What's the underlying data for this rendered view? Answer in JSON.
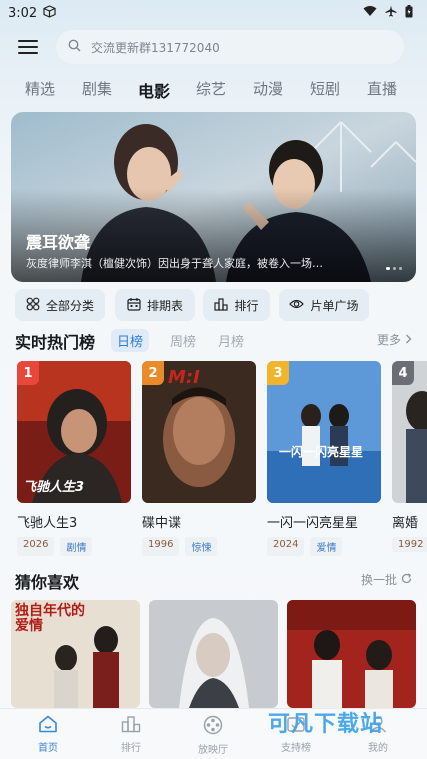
{
  "status_bar": {
    "time": "3:02"
  },
  "search": {
    "placeholder": "交流更新群131772040"
  },
  "tabs": [
    {
      "label": "精选"
    },
    {
      "label": "剧集"
    },
    {
      "label": "电影"
    },
    {
      "label": "综艺"
    },
    {
      "label": "动漫"
    },
    {
      "label": "短剧"
    },
    {
      "label": "直播"
    }
  ],
  "banner": {
    "title": "震耳欲聋",
    "description": "灰度律师李淇（檀健次饰）因出身于聋人家庭，被卷入一场…"
  },
  "quick_actions": [
    {
      "label": "全部分类",
      "icon": "grid-icon"
    },
    {
      "label": "排期表",
      "icon": "calendar-icon"
    },
    {
      "label": "排行",
      "icon": "ranking-icon"
    },
    {
      "label": "片单广场",
      "icon": "eye-icon"
    }
  ],
  "hot": {
    "title": "实时热门榜",
    "tabs": [
      {
        "label": "日榜"
      },
      {
        "label": "周榜"
      },
      {
        "label": "月榜"
      }
    ],
    "more": "更多",
    "items": [
      {
        "rank": "1",
        "name": "飞驰人生3",
        "year": "2026",
        "genre": "剧情",
        "poster_title": "飞驰人生3",
        "badge_color": "#e8473c"
      },
      {
        "rank": "2",
        "name": "碟中谍",
        "year": "1996",
        "genre": "惊悚",
        "poster_title": "M:I",
        "badge_color": "#e98a2b"
      },
      {
        "rank": "3",
        "name": "一闪一闪亮星星",
        "year": "2024",
        "genre": "爱情",
        "poster_title": "一闪一闪亮星星",
        "badge_color": "#f1b52c"
      },
      {
        "rank": "4",
        "name": "离婚",
        "year": "1992",
        "genre": "",
        "poster_title": "",
        "badge_color": "#6b6f75"
      }
    ]
  },
  "recommend": {
    "title": "猜你喜欢",
    "refresh": "换一批",
    "items": [
      {
        "poster_title": "独自年代的 爱情"
      },
      {
        "poster_title": ""
      },
      {
        "poster_title": ""
      }
    ]
  },
  "bottom_nav": [
    {
      "label": "首页",
      "icon": "home-icon"
    },
    {
      "label": "排行",
      "icon": "ranking-icon"
    },
    {
      "label": "放映厅",
      "icon": "film-reel-icon"
    },
    {
      "label": "支持榜",
      "icon": "support-icon"
    },
    {
      "label": "我的",
      "icon": "user-icon"
    }
  ],
  "watermark": "可凡下载站"
}
